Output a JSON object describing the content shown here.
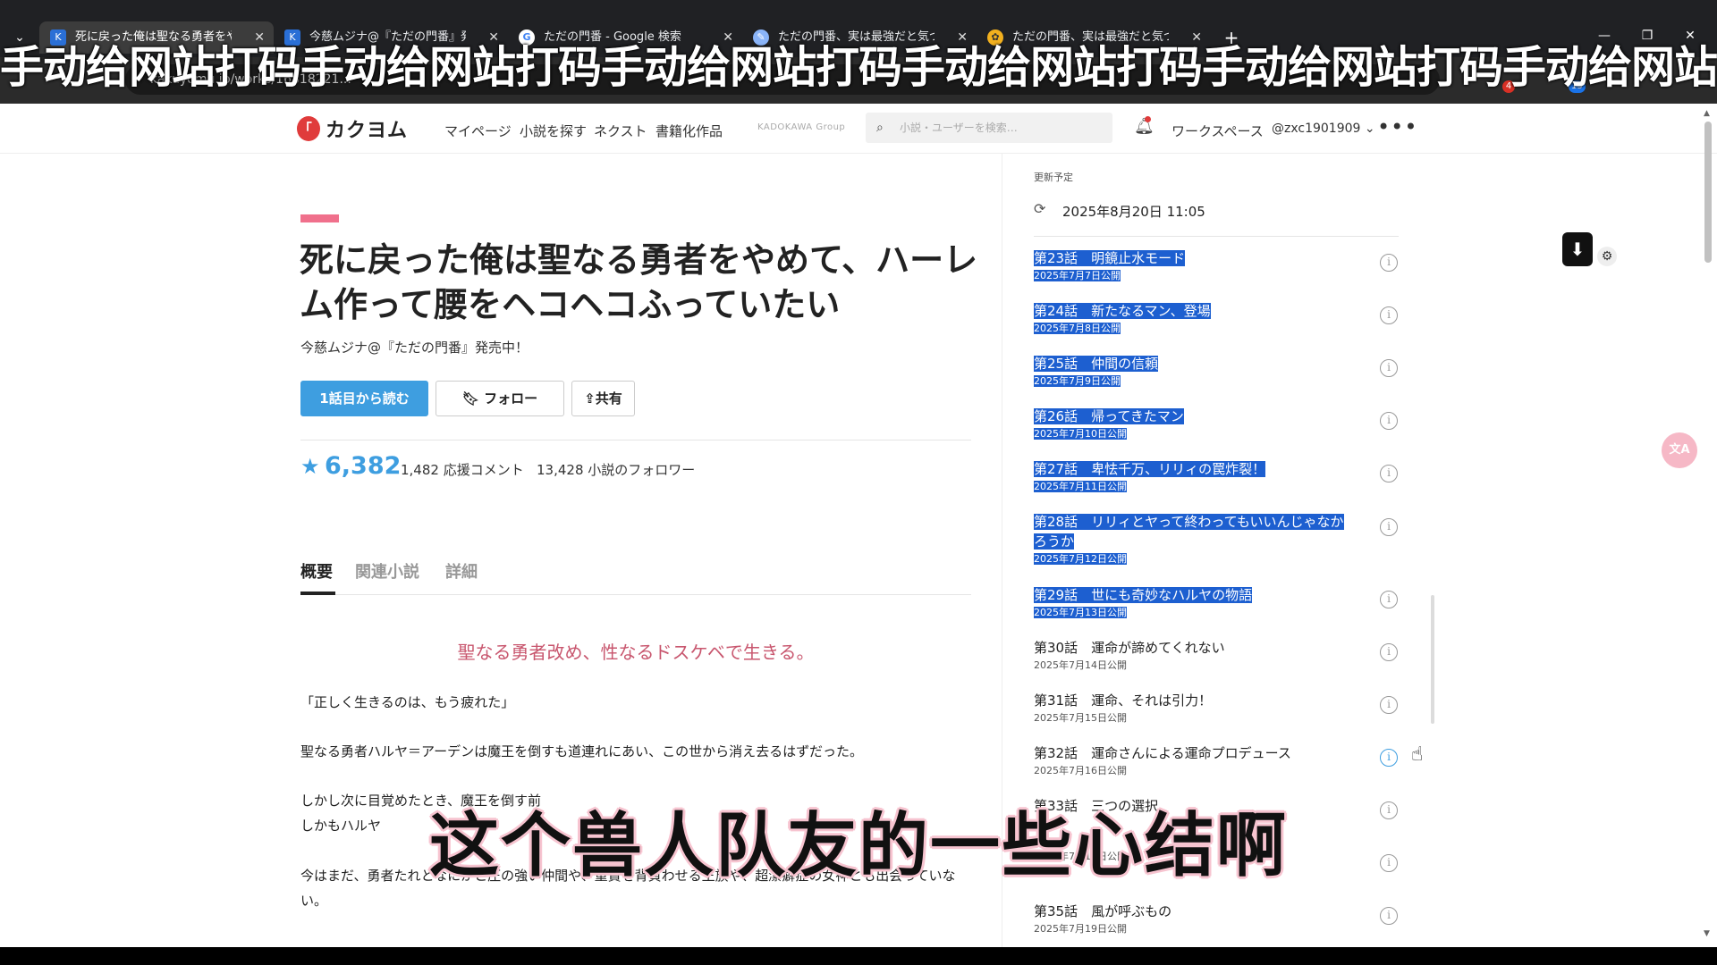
{
  "browser": {
    "tabs": [
      {
        "title": "死に戻った俺は聖なる勇者をや",
        "active": true,
        "icon": "kakuyomu-icon"
      },
      {
        "title": "今慈ムジナ@『ただの門番』発",
        "active": false,
        "icon": "kakuyomu-icon"
      },
      {
        "title": "ただの門番 - Google 検索",
        "active": false,
        "icon": "google-icon"
      },
      {
        "title": "ただの門番、実は最強だと気づ",
        "active": false,
        "icon": "site-icon"
      },
      {
        "title": "ただの門番、実は最強だと気づ",
        "active": false,
        "icon": "site-icon"
      }
    ],
    "url": "kakuyomu.jp/works/16818221...",
    "badges": [
      "4",
      "15"
    ]
  },
  "overlay_top": "手动给网站打码手动给网站打码手动给网站打码手动给网站打码手动给网站打码手动给网站",
  "site": {
    "logo": "カクヨム",
    "nav": [
      "マイページ",
      "小説を探す",
      "ネクスト",
      "書籍化作品"
    ],
    "group": "KADOKAWA Group",
    "search_placeholder": "小説・ユーザーを検索…",
    "workspace": "ワークスペース",
    "user": "@zxc1901909"
  },
  "work": {
    "title": "死に戻った俺は聖なる勇者をやめて、ハーレム作って腰をヘコヘコふっていたい",
    "author": "今慈ムジナ@『ただの門番』発売中！",
    "read_button": "1話目から読む",
    "follow_button": "フォロー",
    "share_button": "共有",
    "stars": "6,382",
    "comments": "1,482 応援コメント",
    "followers": "13,428 小説のフォロワー",
    "tabs": [
      "概要",
      "関連小説",
      "詳細"
    ],
    "catchphrase": "聖なる勇者改め、性なるドスケベで生きる。",
    "paragraphs": [
      "「正しく生きるのは、もう疲れた」",
      "聖なる勇者ハルヤ＝アーデンは魔王を倒すも道連れにあい、この世から消え去るはずだった。",
      "しかし次に目覚めたとき、魔王を倒す前",
      "しかもハルヤ",
      "今はまだ、勇者たれとなにかと圧の強い仲間や、重責を背負わせる王族や、超潔癖症の女神とも出会っていない。"
    ]
  },
  "sidebar": {
    "update_label": "更新予定",
    "update_date": "2025年8月20日 11:05",
    "episodes": [
      {
        "title": "第23話　明鏡止水モード",
        "date": "2025年7月7日公開",
        "selected": true
      },
      {
        "title": "第24話　新たなるマン、登場",
        "date": "2025年7月8日公開",
        "selected": true
      },
      {
        "title": "第25話　仲間の信頼",
        "date": "2025年7月9日公開",
        "selected": true
      },
      {
        "title": "第26話　帰ってきたマン",
        "date": "2025年7月10日公開",
        "selected": true
      },
      {
        "title": "第27話　卑怯千万、リリィの罠炸裂！",
        "date": "2025年7月11日公開",
        "selected": true
      },
      {
        "title": "第28話　リリィとヤって終わってもいいんじゃなかろうか",
        "date": "2025年7月12日公開",
        "selected": true
      },
      {
        "title": "第29話　世にも奇妙なハルヤの物語",
        "date": "2025年7月13日公開",
        "selected": true
      },
      {
        "title": "第30話　運命が諦めてくれない",
        "date": "2025年7月14日公開",
        "selected": false
      },
      {
        "title": "第31話　運命、それは引力！",
        "date": "2025年7月15日公開",
        "selected": false
      },
      {
        "title": "第32話　運命さんによる運命プロデュース",
        "date": "2025年7月16日公開",
        "selected": false
      },
      {
        "title": "第33話　三つの選択",
        "date": "",
        "selected": false
      },
      {
        "title": "",
        "date": "2025年7月18日公開",
        "selected": false
      },
      {
        "title": "第35話　風が呼ぶもの",
        "date": "2025年7月19日公開",
        "selected": false
      }
    ]
  },
  "subtitle": "这个兽人队友的一些心结啊"
}
